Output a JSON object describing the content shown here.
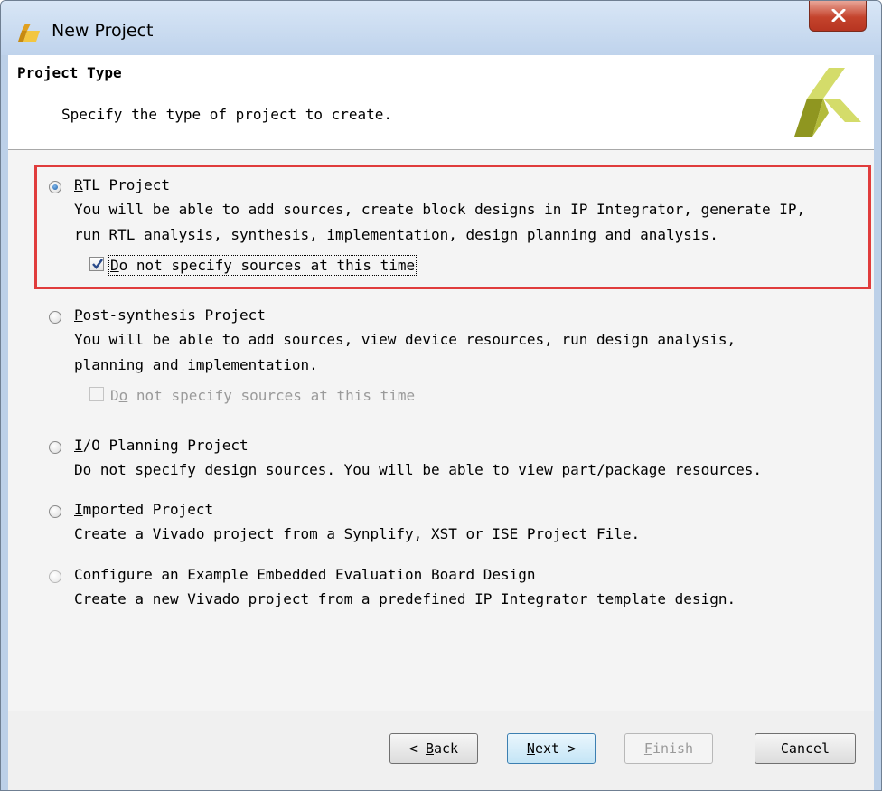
{
  "window": {
    "title": "New Project",
    "close_icon": "close-icon",
    "app_icon": "vivado-icon"
  },
  "header": {
    "title": "Project Type",
    "subtitle": "Specify the type of project to create."
  },
  "options": [
    {
      "id": "rtl",
      "selected": true,
      "enabled": true,
      "mnemonic": "R",
      "label_rest": "TL Project",
      "description": [
        "You will be able to add sources, create block designs in IP Integrator, generate IP,",
        "run RTL analysis, synthesis, implementation, design planning and analysis."
      ],
      "checkbox": {
        "checked": true,
        "enabled": true,
        "mnemonic": "D",
        "label_rest": "o not specify sources at this time"
      }
    },
    {
      "id": "post_synthesis",
      "selected": false,
      "enabled": true,
      "mnemonic": "P",
      "label_rest": "ost-synthesis Project",
      "description": [
        "You will be able to add sources, view device resources, run design analysis,",
        "planning and implementation."
      ],
      "checkbox": {
        "checked": false,
        "enabled": false,
        "label_pre": "D",
        "mnemonic": "o",
        "label_rest": " not specify sources at this time"
      }
    },
    {
      "id": "io_planning",
      "selected": false,
      "enabled": true,
      "mnemonic": "I",
      "label_rest": "/O Planning Project",
      "description": [
        "Do not specify design sources. You will be able to view part/package resources."
      ]
    },
    {
      "id": "imported",
      "selected": false,
      "enabled": true,
      "mnemonic": "I",
      "label_rest": "mported Project",
      "description": [
        "Create a Vivado project from a Synplify, XST or ISE Project File."
      ]
    },
    {
      "id": "example",
      "selected": false,
      "enabled": false,
      "mnemonic": "",
      "label_rest": "Configure an Example Embedded Evaluation Board Design",
      "description": [
        "Create a new Vivado project from a predefined IP Integrator template design."
      ]
    }
  ],
  "buttons": {
    "back": {
      "pre": "< ",
      "mnemonic": "B",
      "rest": "ack",
      "enabled": true
    },
    "next": {
      "mnemonic": "N",
      "rest": "ext >",
      "enabled": true
    },
    "finish": {
      "mnemonic": "F",
      "rest": "inish",
      "enabled": false
    },
    "cancel": {
      "label": "Cancel",
      "enabled": true
    }
  },
  "colors": {
    "highlight_border": "#e03c3c",
    "titlebar": "#bfd3ec",
    "close_button": "#c4432c",
    "logo_yellow": "#d4dc6a",
    "logo_olive": "#8f9620"
  }
}
